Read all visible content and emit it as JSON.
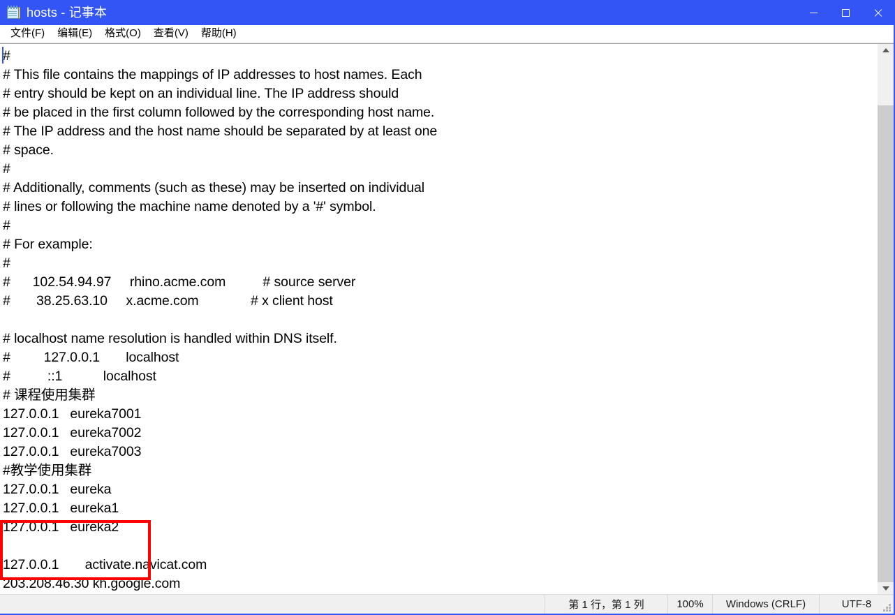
{
  "window": {
    "title": "hosts - 记事本",
    "icon": "notepad-icon",
    "accent_color": "#3355f5",
    "caption": {
      "minimize": "minimize-icon",
      "maximize": "maximize-icon",
      "close": "close-icon"
    }
  },
  "menubar": {
    "items": [
      {
        "label": "文件(F)"
      },
      {
        "label": "编辑(E)"
      },
      {
        "label": "格式(O)"
      },
      {
        "label": "查看(V)"
      },
      {
        "label": "帮助(H)"
      }
    ]
  },
  "editor": {
    "lines": [
      "#",
      "# This file contains the mappings of IP addresses to host names. Each",
      "# entry should be kept on an individual line. The IP address should",
      "# be placed in the first column followed by the corresponding host name.",
      "# The IP address and the host name should be separated by at least one",
      "# space.",
      "#",
      "# Additionally, comments (such as these) may be inserted on individual",
      "# lines or following the machine name denoted by a '#' symbol.",
      "#",
      "# For example:",
      "#",
      "#      102.54.94.97     rhino.acme.com          # source server",
      "#       38.25.63.10     x.acme.com              # x client host",
      "",
      "# localhost name resolution is handled within DNS itself.",
      "#         127.0.0.1       localhost",
      "#          ::1           localhost",
      "# 课程使用集群",
      "127.0.0.1   eureka7001",
      "127.0.0.1   eureka7002",
      "127.0.0.1   eureka7003",
      "#教学使用集群",
      "127.0.0.1   eureka",
      "127.0.0.1   eureka1",
      "127.0.0.1   eureka2",
      "",
      "127.0.0.1       activate.navicat.com",
      "203.208.46.30 kh.google.com"
    ],
    "annotation": {
      "type": "highlight-rectangle",
      "color": "#fe0000",
      "covers_lines": [
        "127.0.0.1   eureka",
        "127.0.0.1   eureka1",
        "127.0.0.1   eureka2"
      ]
    }
  },
  "scrollbar": {
    "up_arrow": "scroll-up-icon",
    "down_arrow": "scroll-down-icon"
  },
  "statusbar": {
    "position": "第 1 行，第 1 列",
    "zoom": "100%",
    "line_ending": "Windows (CRLF)",
    "encoding": "UTF-8"
  }
}
